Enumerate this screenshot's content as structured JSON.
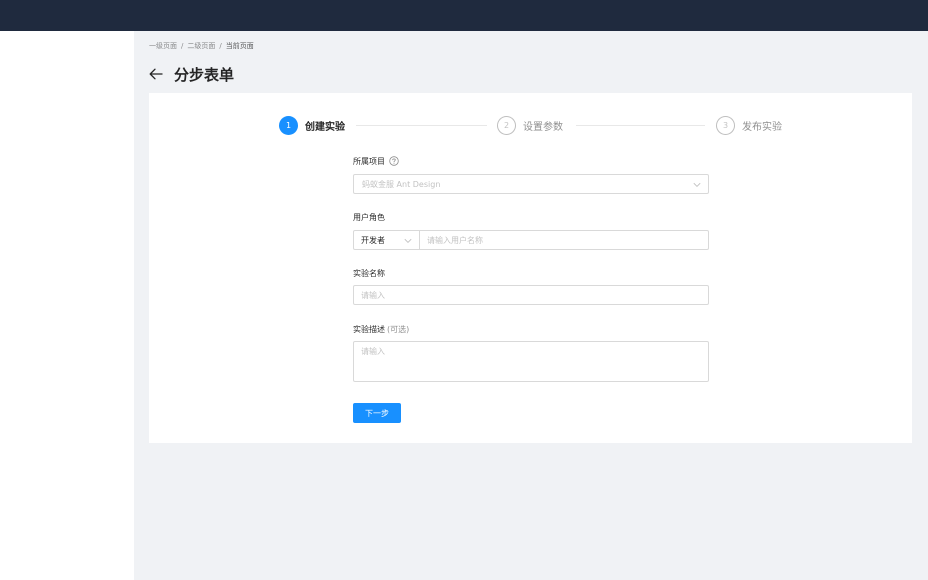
{
  "breadcrumb": {
    "items": [
      "一级页面",
      "二级页面",
      "当前页面"
    ],
    "separator": "/"
  },
  "page": {
    "title": "分步表单",
    "back_icon": "arrow-left-icon"
  },
  "steps": [
    {
      "number": "1",
      "title": "创建实验",
      "status": "active"
    },
    {
      "number": "2",
      "title": "设置参数",
      "status": "wait"
    },
    {
      "number": "3",
      "title": "发布实验",
      "status": "wait"
    }
  ],
  "form": {
    "project": {
      "label": "所属项目",
      "help_icon": "question-circle-icon",
      "placeholder": "蚂蚁金服 Ant Design"
    },
    "role": {
      "label": "用户角色",
      "select_value": "开发者",
      "input_placeholder": "请输入用户名称"
    },
    "name": {
      "label": "实验名称",
      "placeholder": "请输入"
    },
    "description": {
      "label": "实验描述",
      "optional": "(可选)",
      "placeholder": "请输入"
    },
    "next_button": "下一步"
  },
  "colors": {
    "header_bg": "#1f2a3e",
    "primary": "#1890ff",
    "page_bg": "#f0f2f5"
  }
}
